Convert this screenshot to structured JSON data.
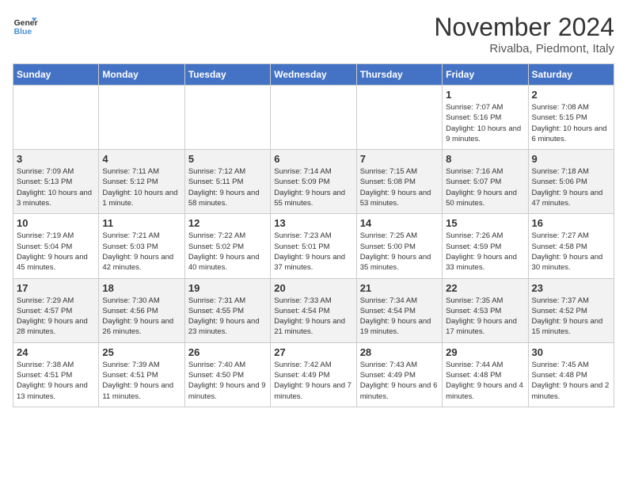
{
  "header": {
    "logo_line1": "General",
    "logo_line2": "Blue",
    "month": "November 2024",
    "location": "Rivalba, Piedmont, Italy"
  },
  "days_of_week": [
    "Sunday",
    "Monday",
    "Tuesday",
    "Wednesday",
    "Thursday",
    "Friday",
    "Saturday"
  ],
  "rows": [
    [
      {
        "day": "",
        "info": ""
      },
      {
        "day": "",
        "info": ""
      },
      {
        "day": "",
        "info": ""
      },
      {
        "day": "",
        "info": ""
      },
      {
        "day": "",
        "info": ""
      },
      {
        "day": "1",
        "info": "Sunrise: 7:07 AM\nSunset: 5:16 PM\nDaylight: 10 hours and 9 minutes."
      },
      {
        "day": "2",
        "info": "Sunrise: 7:08 AM\nSunset: 5:15 PM\nDaylight: 10 hours and 6 minutes."
      }
    ],
    [
      {
        "day": "3",
        "info": "Sunrise: 7:09 AM\nSunset: 5:13 PM\nDaylight: 10 hours and 3 minutes."
      },
      {
        "day": "4",
        "info": "Sunrise: 7:11 AM\nSunset: 5:12 PM\nDaylight: 10 hours and 1 minute."
      },
      {
        "day": "5",
        "info": "Sunrise: 7:12 AM\nSunset: 5:11 PM\nDaylight: 9 hours and 58 minutes."
      },
      {
        "day": "6",
        "info": "Sunrise: 7:14 AM\nSunset: 5:09 PM\nDaylight: 9 hours and 55 minutes."
      },
      {
        "day": "7",
        "info": "Sunrise: 7:15 AM\nSunset: 5:08 PM\nDaylight: 9 hours and 53 minutes."
      },
      {
        "day": "8",
        "info": "Sunrise: 7:16 AM\nSunset: 5:07 PM\nDaylight: 9 hours and 50 minutes."
      },
      {
        "day": "9",
        "info": "Sunrise: 7:18 AM\nSunset: 5:06 PM\nDaylight: 9 hours and 47 minutes."
      }
    ],
    [
      {
        "day": "10",
        "info": "Sunrise: 7:19 AM\nSunset: 5:04 PM\nDaylight: 9 hours and 45 minutes."
      },
      {
        "day": "11",
        "info": "Sunrise: 7:21 AM\nSunset: 5:03 PM\nDaylight: 9 hours and 42 minutes."
      },
      {
        "day": "12",
        "info": "Sunrise: 7:22 AM\nSunset: 5:02 PM\nDaylight: 9 hours and 40 minutes."
      },
      {
        "day": "13",
        "info": "Sunrise: 7:23 AM\nSunset: 5:01 PM\nDaylight: 9 hours and 37 minutes."
      },
      {
        "day": "14",
        "info": "Sunrise: 7:25 AM\nSunset: 5:00 PM\nDaylight: 9 hours and 35 minutes."
      },
      {
        "day": "15",
        "info": "Sunrise: 7:26 AM\nSunset: 4:59 PM\nDaylight: 9 hours and 33 minutes."
      },
      {
        "day": "16",
        "info": "Sunrise: 7:27 AM\nSunset: 4:58 PM\nDaylight: 9 hours and 30 minutes."
      }
    ],
    [
      {
        "day": "17",
        "info": "Sunrise: 7:29 AM\nSunset: 4:57 PM\nDaylight: 9 hours and 28 minutes."
      },
      {
        "day": "18",
        "info": "Sunrise: 7:30 AM\nSunset: 4:56 PM\nDaylight: 9 hours and 26 minutes."
      },
      {
        "day": "19",
        "info": "Sunrise: 7:31 AM\nSunset: 4:55 PM\nDaylight: 9 hours and 23 minutes."
      },
      {
        "day": "20",
        "info": "Sunrise: 7:33 AM\nSunset: 4:54 PM\nDaylight: 9 hours and 21 minutes."
      },
      {
        "day": "21",
        "info": "Sunrise: 7:34 AM\nSunset: 4:54 PM\nDaylight: 9 hours and 19 minutes."
      },
      {
        "day": "22",
        "info": "Sunrise: 7:35 AM\nSunset: 4:53 PM\nDaylight: 9 hours and 17 minutes."
      },
      {
        "day": "23",
        "info": "Sunrise: 7:37 AM\nSunset: 4:52 PM\nDaylight: 9 hours and 15 minutes."
      }
    ],
    [
      {
        "day": "24",
        "info": "Sunrise: 7:38 AM\nSunset: 4:51 PM\nDaylight: 9 hours and 13 minutes."
      },
      {
        "day": "25",
        "info": "Sunrise: 7:39 AM\nSunset: 4:51 PM\nDaylight: 9 hours and 11 minutes."
      },
      {
        "day": "26",
        "info": "Sunrise: 7:40 AM\nSunset: 4:50 PM\nDaylight: 9 hours and 9 minutes."
      },
      {
        "day": "27",
        "info": "Sunrise: 7:42 AM\nSunset: 4:49 PM\nDaylight: 9 hours and 7 minutes."
      },
      {
        "day": "28",
        "info": "Sunrise: 7:43 AM\nSunset: 4:49 PM\nDaylight: 9 hours and 6 minutes."
      },
      {
        "day": "29",
        "info": "Sunrise: 7:44 AM\nSunset: 4:48 PM\nDaylight: 9 hours and 4 minutes."
      },
      {
        "day": "30",
        "info": "Sunrise: 7:45 AM\nSunset: 4:48 PM\nDaylight: 9 hours and 2 minutes."
      }
    ]
  ]
}
